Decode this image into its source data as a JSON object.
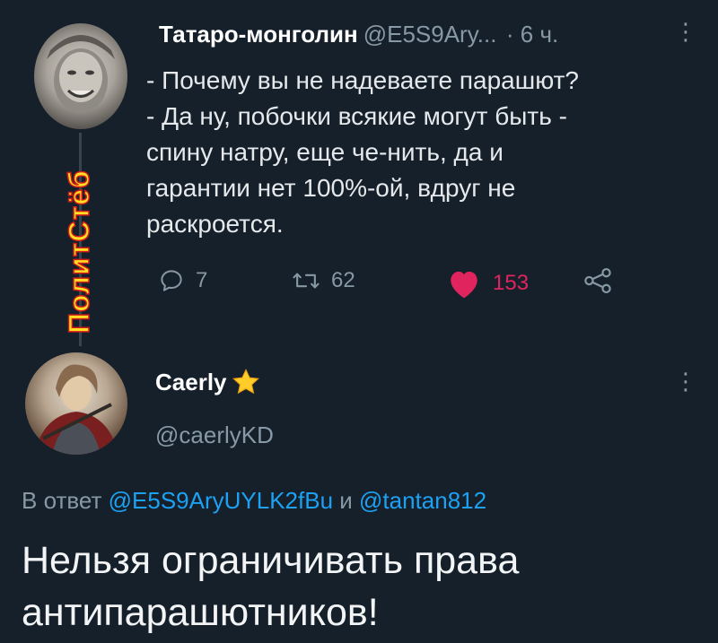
{
  "watermark": "ПолитСтёб",
  "tweet1": {
    "author": "Татаро-монголин",
    "handle": "@E5S9Ary...",
    "time": "· 6 ч.",
    "lines": [
      "- Почему вы не надеваете парашют?",
      "- Да ну, побочки всякие могут быть -",
      "спину натру, еще че-нить, да и",
      "гарантии нет 100%-ой, вдруг не",
      "раскроется."
    ],
    "replies": "7",
    "retweets": "62",
    "likes": "153",
    "icons": {
      "reply": "comment-icon",
      "retweet": "retweet-icon",
      "like": "heart-icon",
      "share": "share-icon",
      "more": "more-vertical-icon"
    },
    "like_color": "#e0245e"
  },
  "tweet2": {
    "author": "Caerly",
    "badge": "star-emoji",
    "handle": "@caerlyKD",
    "reply_prefix": "В ответ",
    "reply_user1": "@E5S9AryUYLK2fBu",
    "reply_join": "и",
    "reply_user2": "@tantan812",
    "text_lines": [
      "Нельзя ограничивать права",
      "антипарашютников!"
    ],
    "link_color": "#1da1f2"
  }
}
